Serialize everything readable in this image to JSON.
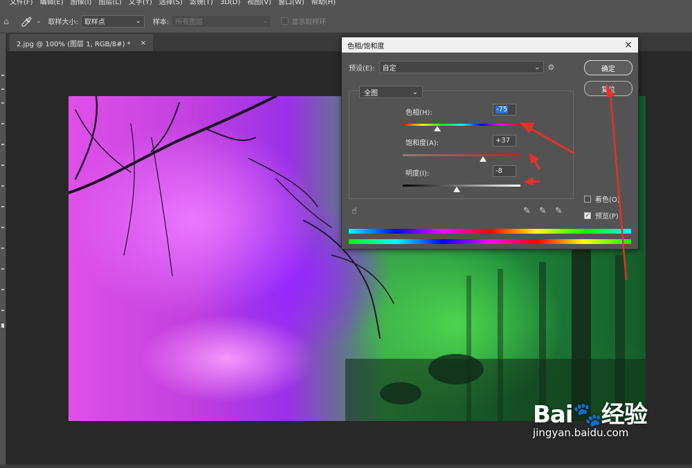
{
  "menubar": {
    "items": [
      "文件(F)",
      "编辑(E)",
      "图像(I)",
      "图层(L)",
      "文字(Y)",
      "选择(S)",
      "滤镜(T)",
      "3D(D)",
      "视图(V)",
      "窗口(W)",
      "帮助(H)"
    ]
  },
  "options": {
    "sample_size_label": "取样大小:",
    "sample_size_value": "取样点",
    "sample_label": "样本:",
    "sample_value": "所有图层",
    "show_ring_label": "显示取样环"
  },
  "document": {
    "tab_title": "2.jpg @ 100% (图层 1, RGB/8#) *",
    "tab_close": "×"
  },
  "dialog": {
    "title": "色相/饱和度",
    "close": "×",
    "preset_label": "预设(E):",
    "preset_value": "自定",
    "ok_label": "确定",
    "reset_label": "复位",
    "channel_value": "全图",
    "hue_label": "色相(H):",
    "hue_value": -75,
    "hue_value_text": "-75",
    "saturation_label": "饱和度(A):",
    "saturation_value": 37,
    "saturation_value_text": "+37",
    "lightness_label": "明度(I):",
    "lightness_value": -8,
    "lightness_value_text": "-8",
    "colorize_label": "着色(O)",
    "colorize_checked": false,
    "preview_label": "预览(P)",
    "preview_checked": true
  },
  "watermark": {
    "logo_text_a": "Bai",
    "logo_text_b": "经验",
    "url": "jingyan.baidu.com"
  },
  "colors": {
    "annotation_arrow": "#e8302a",
    "highlight": "#2a6fd6"
  }
}
